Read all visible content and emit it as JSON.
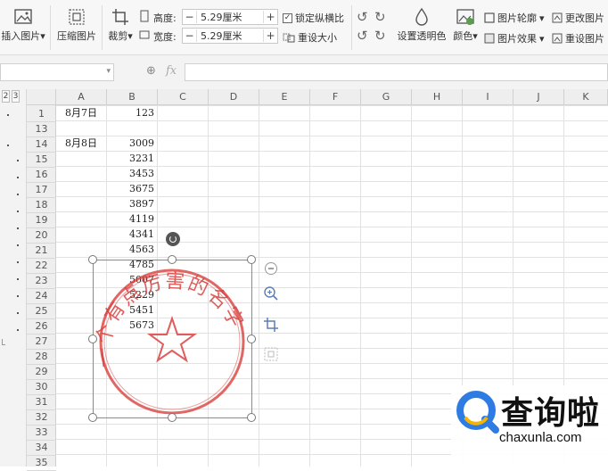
{
  "ribbon": {
    "insert_picture": "插入图片",
    "compress_picture": "压缩图片",
    "crop": "裁剪",
    "height_label": "高度:",
    "height_value": "5.29厘米",
    "width_label": "宽度:",
    "width_value": "5.29厘米",
    "lock_ratio": "锁定纵横比",
    "reset_size": "重设大小",
    "set_transparent": "设置透明色",
    "color": "颜色",
    "picture_outline": "图片轮廓",
    "picture_effects": "图片效果",
    "change_picture": "更改图片",
    "reset_picture": "重设图片",
    "minus": "−",
    "plus": "+"
  },
  "formula_bar": {
    "fx": "fx"
  },
  "outline_levels": [
    "2",
    "3"
  ],
  "columns": [
    "A",
    "B",
    "C",
    "D",
    "E",
    "F",
    "G",
    "H",
    "I",
    "J",
    "K"
  ],
  "rows": [
    "1",
    "13",
    "14",
    "15",
    "16",
    "17",
    "18",
    "19",
    "20",
    "21",
    "22",
    "23",
    "24",
    "25",
    "26",
    "27",
    "28",
    "29",
    "30",
    "31",
    "32",
    "33",
    "34",
    "35"
  ],
  "cells": {
    "a1": "8月7日",
    "b1": "123",
    "a14": "8月8日",
    "b14": "3009",
    "b15": "3231",
    "b16": "3453",
    "b17": "3675",
    "b18": "3897",
    "b19": "4119",
    "b20": "4341",
    "b21": "4563",
    "b22": "4785",
    "b23": "5007",
    "b24": "5229",
    "b25": "5451",
    "b26": "5673"
  },
  "stamp": {
    "text": "一个有点厉害的名字",
    "color": "#d9413f"
  },
  "watermark": {
    "cn": "查询啦",
    "en": "chaxunla.com"
  }
}
